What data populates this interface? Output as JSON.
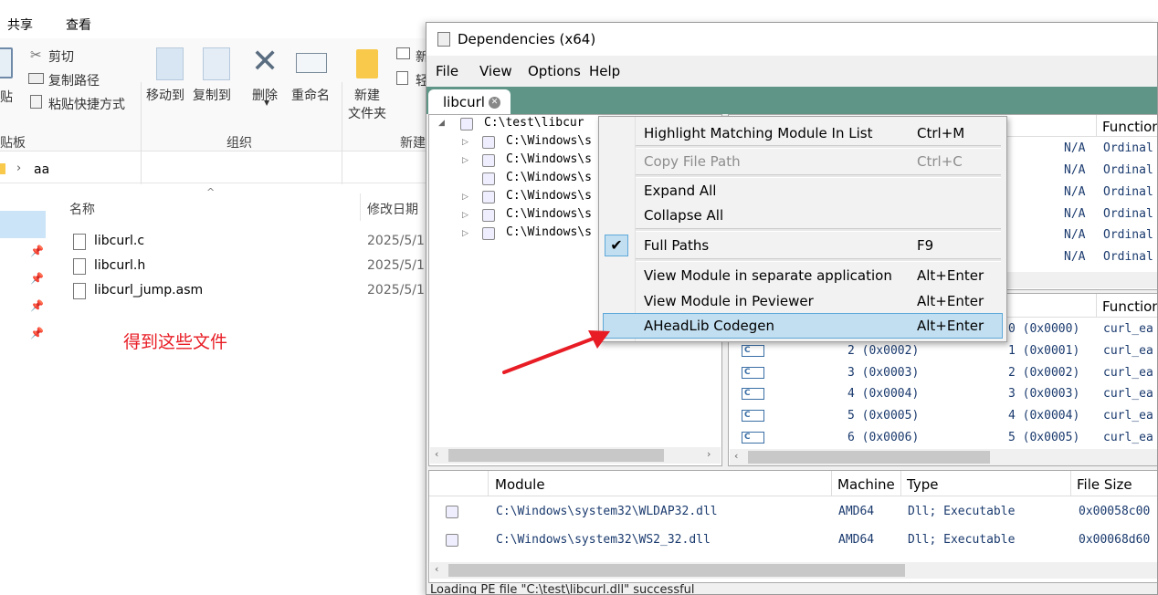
{
  "explorer": {
    "ribbon_tabs": [
      "共享",
      "查看"
    ],
    "clipboard": {
      "paste_fragment": "贴",
      "cut": "剪切",
      "copy_path": "复制路径",
      "paste_shortcut": "粘贴快捷方式",
      "group_fragment": "贴板"
    },
    "organize": {
      "move_to": "移动到",
      "copy_to": "复制到",
      "delete": "删除",
      "rename": "重命名",
      "group": "组织"
    },
    "new": {
      "new_folder_line1": "新建",
      "new_folder_line2": "文件夹",
      "new_item_fragment": "新",
      "easy_access_fragment": "轻",
      "group_fragment": "新建"
    },
    "address": {
      "folder": "aa"
    },
    "columns": {
      "name": "名称",
      "modified": "修改日期"
    },
    "files": [
      {
        "name": "libcurl.c",
        "date": "2025/5/1"
      },
      {
        "name": "libcurl.h",
        "date": "2025/5/1"
      },
      {
        "name": "libcurl_jump.asm",
        "date": "2025/5/1"
      }
    ],
    "note": "得到这些文件"
  },
  "dependencies": {
    "title": "Dependencies (x64)",
    "menu": [
      "File",
      "View",
      "Options",
      "Help"
    ],
    "tab": "libcurl",
    "tree": {
      "root": "C:\\test\\libcur",
      "children": [
        "C:\\Windows\\s",
        "C:\\Windows\\s",
        "C:\\Windows\\s",
        "C:\\Windows\\s",
        "C:\\Windows\\s",
        "C:\\Windows\\s"
      ]
    },
    "imports": {
      "header_function": "Function",
      "rows": [
        {
          "hint": "N/A",
          "func": "Ordinal"
        },
        {
          "hint": "N/A",
          "func": "Ordinal"
        },
        {
          "hint": "N/A",
          "func": "Ordinal"
        },
        {
          "hint": "N/A",
          "func": "Ordinal"
        },
        {
          "hint": "N/A",
          "func": "Ordinal"
        },
        {
          "hint": "N/A",
          "func": "Ordinal"
        }
      ]
    },
    "exports": {
      "header_function": "Function",
      "rows": [
        {
          "ordinal": "",
          "hint": "0 (0x0000)",
          "func": "curl_ea"
        },
        {
          "ordinal": "2 (0x0002)",
          "hint": "1 (0x0001)",
          "func": "curl_ea"
        },
        {
          "ordinal": "3 (0x0003)",
          "hint": "2 (0x0002)",
          "func": "curl_ea"
        },
        {
          "ordinal": "4 (0x0004)",
          "hint": "3 (0x0003)",
          "func": "curl_ea"
        },
        {
          "ordinal": "5 (0x0005)",
          "hint": "4 (0x0004)",
          "func": "curl_ea"
        },
        {
          "ordinal": "6 (0x0006)",
          "hint": "5 (0x0005)",
          "func": "curl_ea"
        }
      ]
    },
    "modules": {
      "headers": {
        "module": "Module",
        "machine": "Machine",
        "type": "Type",
        "size": "File Size"
      },
      "rows": [
        {
          "module": "C:\\Windows\\system32\\WLDAP32.dll",
          "machine": "AMD64",
          "type": "Dll; Executable",
          "size": "0x00058c00"
        },
        {
          "module": "C:\\Windows\\system32\\WS2_32.dll",
          "machine": "AMD64",
          "type": "Dll; Executable",
          "size": "0x00068d60"
        }
      ]
    },
    "status": "Loading PE file \"C:\\test\\libcurl.dll\" successful"
  },
  "context_menu": {
    "items": [
      {
        "label": "Highlight Matching Module In List",
        "shortcut": "Ctrl+M"
      },
      {
        "label": "Copy File Path",
        "shortcut": "Ctrl+C"
      },
      {
        "label": "Expand All",
        "shortcut": ""
      },
      {
        "label": "Collapse All",
        "shortcut": ""
      },
      {
        "label": "Full Paths",
        "shortcut": "F9"
      },
      {
        "label": "View Module in separate application",
        "shortcut": "Alt+Enter"
      },
      {
        "label": "View Module in Peviewer",
        "shortcut": "Alt+Enter"
      },
      {
        "label": "AHeadLib Codegen",
        "shortcut": "Alt+Enter"
      }
    ]
  },
  "colors": {
    "tab_strip": "#5f9587",
    "highlight": "#c2dff1",
    "annotation_red": "#e81c24"
  }
}
